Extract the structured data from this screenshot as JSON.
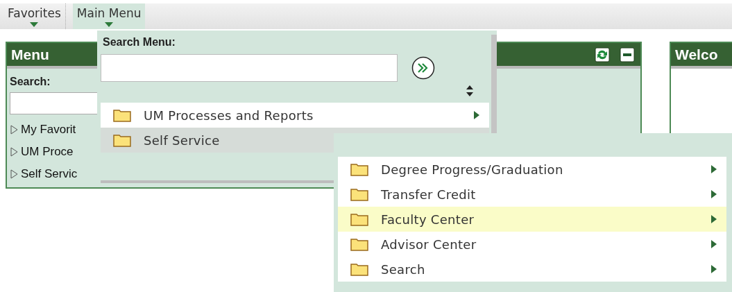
{
  "menubar": [
    {
      "label": "Favorites",
      "selected": false
    },
    {
      "label": "Main Menu",
      "selected": true
    }
  ],
  "menu_pagelet": {
    "title": "Menu",
    "search_label": "Search:",
    "tree": [
      {
        "label": "My Favorit",
        "expanded": false
      },
      {
        "label": "UM Proce",
        "expanded": false
      },
      {
        "label": "Self Servic",
        "expanded": false
      }
    ]
  },
  "welcome_pagelet": {
    "title": "Welco"
  },
  "main_menu": {
    "search_label": "Search Menu:",
    "items": [
      {
        "label": "UM Processes and Reports",
        "selected": false
      },
      {
        "label": "Self Service",
        "selected": true
      }
    ]
  },
  "submenu": {
    "items": [
      {
        "label": "Degree Progress/Graduation",
        "selected": false
      },
      {
        "label": "Transfer Credit",
        "selected": false
      },
      {
        "label": "Faculty Center",
        "selected": true
      },
      {
        "label": "Advisor Center",
        "selected": false
      },
      {
        "label": "Search",
        "selected": false
      }
    ]
  }
}
